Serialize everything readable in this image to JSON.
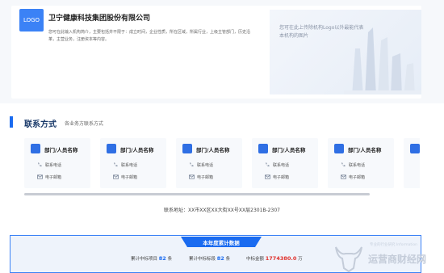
{
  "org": {
    "logo_text": "LOGO",
    "name": "卫宁健康科技集团股份有限公司",
    "description": "您可在此输入机构简介，主要包括并不限于：成立时间，企业性质，所在区域，所属行业，上级主管部门，历史沿革，主营业务，注册资本等内容。"
  },
  "image_note": "您可在此上传除机构Logo以外最能代表本机构的图片",
  "contact": {
    "title": "联系方式",
    "subtitle": "各业务方联系方式",
    "cards": [
      {
        "name": "部门/人员名称",
        "phone": "联系电话",
        "email": "电子邮箱"
      },
      {
        "name": "部门/人员名称",
        "phone": "联系电话",
        "email": "电子邮箱"
      },
      {
        "name": "部门/人员名称",
        "phone": "联系电话",
        "email": "电子邮箱"
      },
      {
        "name": "部门/人员名称",
        "phone": "联系电话",
        "email": "电子邮箱"
      },
      {
        "name": "部门/人员名称",
        "phone": "联系电话",
        "email": "电子邮箱"
      }
    ],
    "address": "联系地址：XX市XX区XX大街XX号XX层2301B-2307"
  },
  "stats": {
    "title": "本年度累计数据",
    "items": [
      {
        "label": "累计中标项目",
        "value": "82",
        "unit": "条"
      },
      {
        "label": "累计中标标段",
        "value": "82",
        "unit": "条"
      },
      {
        "label": "中标金额",
        "value": "1774380.0",
        "unit": "万"
      }
    ]
  },
  "watermark": {
    "top": "专业的行业研究 Information",
    "main": "运营商财经网"
  },
  "colors": {
    "accent": "#1a6bf0",
    "money": "#e0312c",
    "background_top": "#f6f8fb"
  }
}
